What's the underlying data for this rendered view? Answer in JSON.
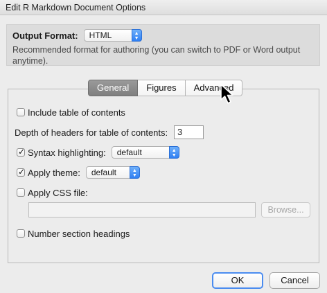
{
  "window": {
    "title": "Edit R Markdown Document Options"
  },
  "output_format": {
    "label": "Output Format:",
    "selected": "HTML",
    "description": "Recommended format for authoring (you can switch to PDF or Word output anytime)."
  },
  "tabs": [
    {
      "label": "General",
      "active": true
    },
    {
      "label": "Figures",
      "active": false
    },
    {
      "label": "Advanced",
      "active": false
    }
  ],
  "general": {
    "toc": {
      "label": "Include table of contents",
      "checked": false
    },
    "toc_depth": {
      "label": "Depth of headers for table of contents:",
      "value": "3"
    },
    "highlight": {
      "label": "Syntax highlighting:",
      "checked": true,
      "selected": "default"
    },
    "theme": {
      "label": "Apply theme:",
      "checked": true,
      "selected": "default"
    },
    "css": {
      "label": "Apply CSS file:",
      "checked": false,
      "value": "",
      "browse_label": "Browse..."
    },
    "number_sections": {
      "label": "Number section headings",
      "checked": false
    }
  },
  "buttons": {
    "ok": "OK",
    "cancel": "Cancel"
  },
  "colors": {
    "accent": "#3b82f6",
    "active_tab": "#8a8a8a"
  },
  "icons": {
    "select_arrows": "up-down-chevron-icon",
    "checkbox_tick": "checkmark-icon",
    "pointer": "mouse-pointer-icon"
  }
}
